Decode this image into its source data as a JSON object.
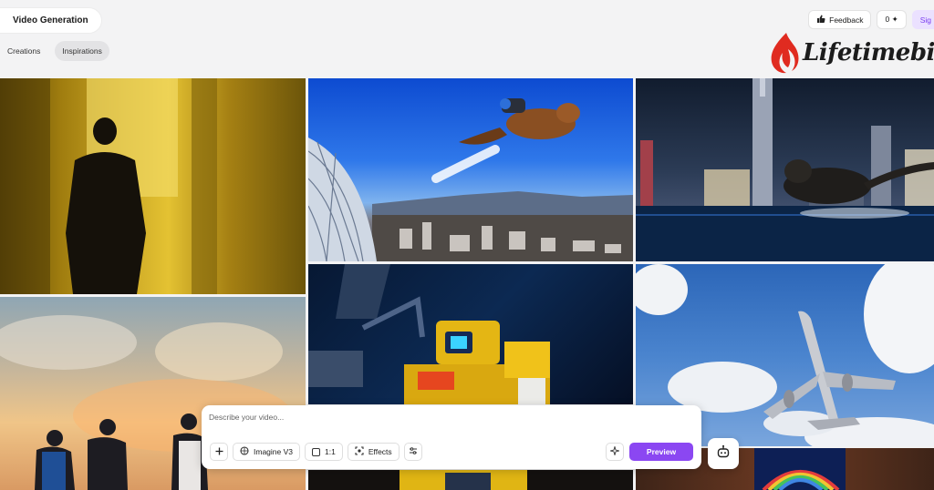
{
  "app": {
    "title": "Video Generation"
  },
  "tabs": [
    {
      "label": "Creations",
      "active": false
    },
    {
      "label": "Inspirations",
      "active": true
    }
  ],
  "top_right": {
    "feedback_label": "Feedback",
    "credits_label": "0 ✦",
    "sign_label": "Sig"
  },
  "logo": {
    "text": "Lifetimebies",
    "color": "#e02b20"
  },
  "gallery": {
    "tiles": [
      {
        "name": "man-silhouette-yellow-room"
      },
      {
        "name": "beaver-jetpack-over-city"
      },
      {
        "name": "cat-running-on-water-city-night"
      },
      {
        "name": "runners-at-sunset"
      },
      {
        "name": "yellow-robot-dark-lab"
      },
      {
        "name": "airplane-blue-sky-clouds"
      },
      {
        "name": "yellow-robot-bottom"
      },
      {
        "name": "rainbow-window-room"
      }
    ]
  },
  "prompt": {
    "placeholder": "Describe your video...",
    "value": "",
    "model_label": "Imagine V3",
    "ratio_label": "1:1",
    "effects_label": "Effects",
    "preview_label": "Preview",
    "accent": "#8b47f2"
  },
  "icons": {
    "add": "plus-icon",
    "model": "model-icon",
    "ratio": "square-icon",
    "effects": "focus-icon",
    "settings": "sliders-icon",
    "enhance": "sparkle-icon",
    "bot": "robot-icon",
    "feedback": "thumbs-up-icon"
  }
}
